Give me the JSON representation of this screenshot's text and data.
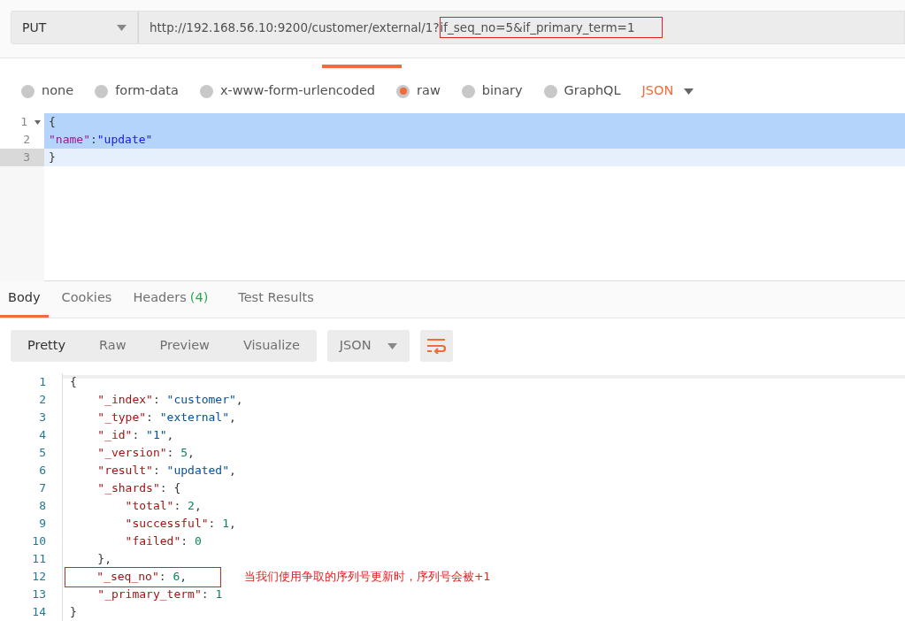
{
  "request": {
    "method": "PUT",
    "url": "http://192.168.56.10:9200/customer/external/1?",
    "url_highlighted": "if_seq_no=5&if_primary_term=1"
  },
  "body_types": [
    {
      "label": "none",
      "selected": false
    },
    {
      "label": "form-data",
      "selected": false
    },
    {
      "label": "x-www-form-urlencoded",
      "selected": false
    },
    {
      "label": "raw",
      "selected": true
    },
    {
      "label": "binary",
      "selected": false
    },
    {
      "label": "GraphQL",
      "selected": false
    }
  ],
  "body_format": "JSON",
  "request_body": [
    {
      "number": "1",
      "selected": true,
      "foldable": true,
      "tokens": [
        {
          "kind": "punct",
          "text": "{"
        }
      ]
    },
    {
      "number": "2",
      "selected": true,
      "foldable": false,
      "tokens": [
        {
          "kind": "key",
          "text": "\"name\""
        },
        {
          "kind": "punct",
          "text": ":"
        },
        {
          "kind": "string",
          "text": "\"update\""
        }
      ]
    },
    {
      "number": "3",
      "selected": false,
      "foldable": false,
      "tokens": [
        {
          "kind": "punct",
          "text": "}"
        }
      ]
    }
  ],
  "response_tabs": [
    {
      "label": "Body",
      "selected": true
    },
    {
      "label": "Cookies",
      "selected": false
    },
    {
      "label": "Headers",
      "count": "(4)",
      "selected": false
    },
    {
      "label": "Test Results",
      "selected": false
    }
  ],
  "view_modes": [
    {
      "label": "Pretty",
      "selected": true
    },
    {
      "label": "Raw",
      "selected": false
    },
    {
      "label": "Preview",
      "selected": false
    },
    {
      "label": "Visualize",
      "selected": false
    }
  ],
  "response_format": "JSON",
  "response_body": [
    {
      "number": "1",
      "highlighted": false,
      "tokens": [
        {
          "kind": "punct",
          "text": "{"
        }
      ]
    },
    {
      "number": "2",
      "highlighted": false,
      "tokens": [
        {
          "kind": "key",
          "text": "    \"_index\""
        },
        {
          "kind": "punct",
          "text": ": "
        },
        {
          "kind": "string",
          "text": "\"customer\""
        },
        {
          "kind": "punct",
          "text": ","
        }
      ]
    },
    {
      "number": "3",
      "highlighted": false,
      "tokens": [
        {
          "kind": "key",
          "text": "    \"_type\""
        },
        {
          "kind": "punct",
          "text": ": "
        },
        {
          "kind": "string",
          "text": "\"external\""
        },
        {
          "kind": "punct",
          "text": ","
        }
      ]
    },
    {
      "number": "4",
      "highlighted": false,
      "tokens": [
        {
          "kind": "key",
          "text": "    \"_id\""
        },
        {
          "kind": "punct",
          "text": ": "
        },
        {
          "kind": "string",
          "text": "\"1\""
        },
        {
          "kind": "punct",
          "text": ","
        }
      ]
    },
    {
      "number": "5",
      "highlighted": false,
      "tokens": [
        {
          "kind": "key",
          "text": "    \"_version\""
        },
        {
          "kind": "punct",
          "text": ": "
        },
        {
          "kind": "number",
          "text": "5"
        },
        {
          "kind": "punct",
          "text": ","
        }
      ]
    },
    {
      "number": "6",
      "highlighted": false,
      "tokens": [
        {
          "kind": "key",
          "text": "    \"result\""
        },
        {
          "kind": "punct",
          "text": ": "
        },
        {
          "kind": "string",
          "text": "\"updated\""
        },
        {
          "kind": "punct",
          "text": ","
        }
      ]
    },
    {
      "number": "7",
      "highlighted": false,
      "tokens": [
        {
          "kind": "key",
          "text": "    \"_shards\""
        },
        {
          "kind": "punct",
          "text": ": {"
        }
      ]
    },
    {
      "number": "8",
      "highlighted": false,
      "tokens": [
        {
          "kind": "key",
          "text": "        \"total\""
        },
        {
          "kind": "punct",
          "text": ": "
        },
        {
          "kind": "number",
          "text": "2"
        },
        {
          "kind": "punct",
          "text": ","
        }
      ]
    },
    {
      "number": "9",
      "highlighted": false,
      "tokens": [
        {
          "kind": "key",
          "text": "        \"successful\""
        },
        {
          "kind": "punct",
          "text": ": "
        },
        {
          "kind": "number",
          "text": "1"
        },
        {
          "kind": "punct",
          "text": ","
        }
      ]
    },
    {
      "number": "10",
      "highlighted": false,
      "tokens": [
        {
          "kind": "key",
          "text": "        \"failed\""
        },
        {
          "kind": "punct",
          "text": ": "
        },
        {
          "kind": "number",
          "text": "0"
        }
      ]
    },
    {
      "number": "11",
      "highlighted": false,
      "tokens": [
        {
          "kind": "punct",
          "text": "    },"
        }
      ]
    },
    {
      "number": "12",
      "highlighted": true,
      "tokens": [
        {
          "kind": "key",
          "text": "    \"_seq_no\""
        },
        {
          "kind": "punct",
          "text": ": "
        },
        {
          "kind": "number",
          "text": "6"
        },
        {
          "kind": "punct",
          "text": ","
        }
      ]
    },
    {
      "number": "13",
      "highlighted": false,
      "tokens": [
        {
          "kind": "key",
          "text": "    \"_primary_term\""
        },
        {
          "kind": "punct",
          "text": ": "
        },
        {
          "kind": "number",
          "text": "1"
        }
      ]
    },
    {
      "number": "14",
      "highlighted": false,
      "tokens": [
        {
          "kind": "punct",
          "text": "}"
        }
      ]
    }
  ],
  "annotation": "当我们使用争取的序列号更新时，序列号会被+1"
}
